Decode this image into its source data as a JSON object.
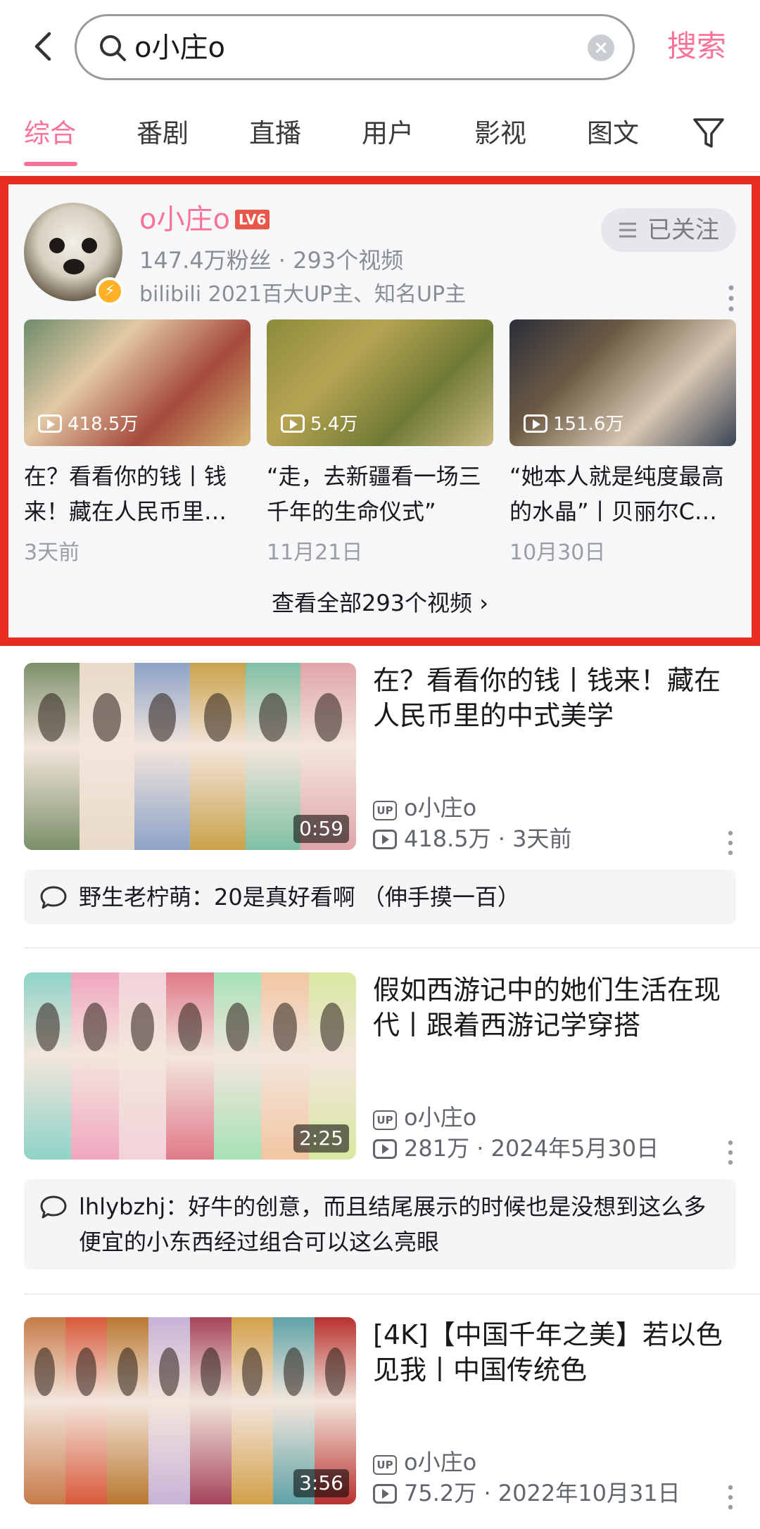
{
  "search": {
    "query": "o小庄o",
    "submit_label": "搜索"
  },
  "tabs": [
    {
      "label": "综合",
      "active": true
    },
    {
      "label": "番剧",
      "active": false
    },
    {
      "label": "直播",
      "active": false
    },
    {
      "label": "用户",
      "active": false
    },
    {
      "label": "影视",
      "active": false
    },
    {
      "label": "图文",
      "active": false
    }
  ],
  "user_card": {
    "name": "o小庄o",
    "level_badge": "LV6",
    "follow_label": "已关注",
    "stats": "147.4万粉丝 · 293个视频",
    "description": "bilibili 2021百大UP主、知名UP主",
    "videos": [
      {
        "views": "418.5万",
        "title": "在？看看你的钱丨钱来！藏在人民币里…",
        "date": "3天前",
        "colors": [
          "#6d8c6b",
          "#e2c9a5",
          "#a54a3c",
          "#d3b26d"
        ]
      },
      {
        "views": "5.4万",
        "title": "“走，去新疆看一场三千年的生命仪式”",
        "date": "11月21日",
        "colors": [
          "#8a8b3a",
          "#b7a453",
          "#6f7a34",
          "#c9b981"
        ]
      },
      {
        "views": "151.6万",
        "title": "“她本人就是纯度最高的水晶”丨贝丽尔C…",
        "date": "10月30日",
        "colors": [
          "#2b2f3a",
          "#6d5a45",
          "#d8c7b2",
          "#3a4455"
        ]
      }
    ],
    "view_all_label": "查看全部293个视频 ›"
  },
  "video_list": [
    {
      "title": "在？看看你的钱丨钱来！藏在人民币里的中式美学",
      "duration": "0:59",
      "uploader": "o小庄o",
      "views": "418.5万",
      "date": "3天前",
      "strip_colors": [
        "#7b8f6a",
        "#e8d9c8",
        "#8da3c7",
        "#c9a24a",
        "#7fc0a4",
        "#e0a5a8"
      ],
      "comment": {
        "author": "野生老柠萌",
        "text": "野生老柠萌：20是真好看啊 （伸手摸一百）"
      }
    },
    {
      "title": "假如西游记中的她们生活在现代丨跟着西游记学穿搭",
      "duration": "2:25",
      "uploader": "o小庄o",
      "views": "281万",
      "date": "2024年5月30日",
      "strip_colors": [
        "#8ed3c8",
        "#f0a6c0",
        "#f2d2d9",
        "#e07a8a",
        "#a7e1b6",
        "#f1c6a2",
        "#d8e8a0"
      ],
      "comment": {
        "author": "lhlybzhj",
        "text": "lhlybzhj：好牛的创意，而且结尾展示的时候也是没想到这么多便宜的小东西经过组合可以这么亮眼"
      }
    },
    {
      "title": "[4K]【中国千年之美】若以色见我丨中国传统色",
      "duration": "3:56",
      "uploader": "o小庄o",
      "views": "75.2万",
      "date": "2022年10月31日",
      "strip_colors": [
        "#c77b4a",
        "#d95a3b",
        "#b9782f",
        "#c7b3d7",
        "#a5445d",
        "#d2a04a",
        "#5fa3a7",
        "#b8322f"
      ]
    }
  ],
  "theme": {
    "accent": "#fb7299",
    "highlight_border": "#e62d20"
  }
}
